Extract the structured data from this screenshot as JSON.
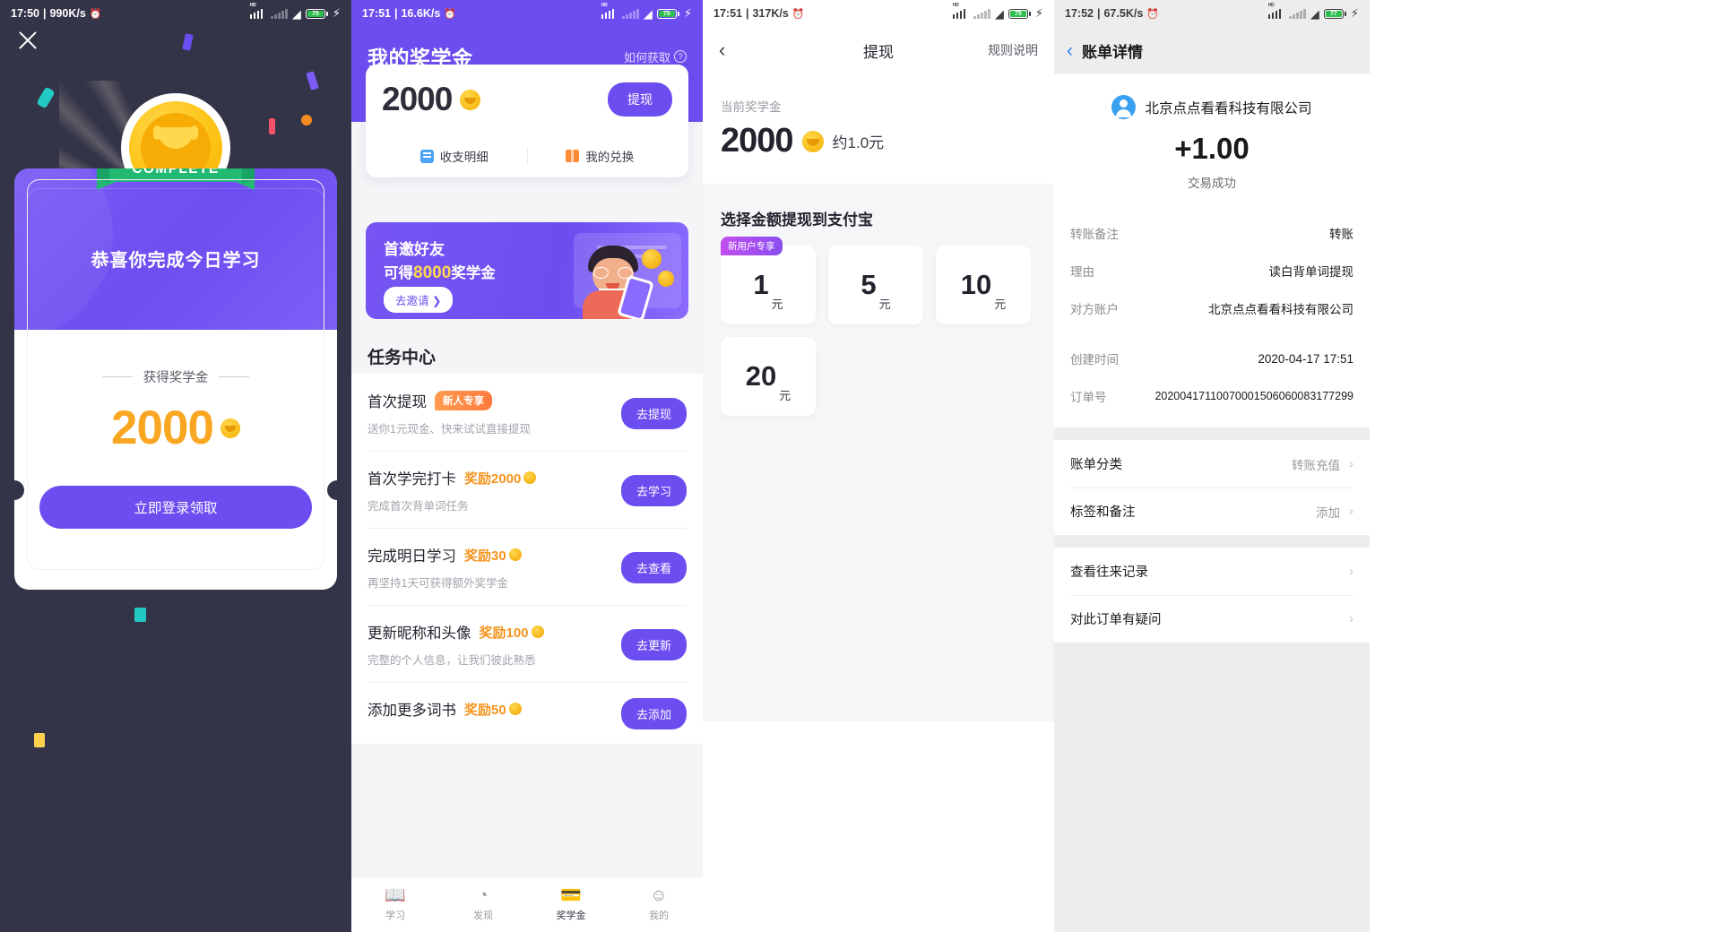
{
  "panel1": {
    "status": {
      "time": "17:50",
      "speed": "990K/s",
      "battery": "75",
      "network": "HD"
    },
    "close_icon": "close-icon",
    "ribbon_label": "COMPLETE",
    "congrats": "恭喜你完成今日学习",
    "got_label": "获得奖学金",
    "amount": "2000",
    "cta_label": "立即登录领取"
  },
  "panel2": {
    "status": {
      "time": "17:51",
      "speed": "16.6K/s",
      "battery": "75",
      "network": "HD"
    },
    "title": "我的奖学金",
    "howto": "如何获取",
    "balance": "2000",
    "withdraw_button": "提现",
    "links": [
      {
        "label": "收支明细",
        "icon": "list-icon"
      },
      {
        "label": "我的兑换",
        "icon": "gift-icon"
      }
    ],
    "banner": {
      "line1": "首邀好友",
      "line2_pre": "可得",
      "line2_num": "8000",
      "line2_post": "奖学金",
      "button": "去邀请 ❯"
    },
    "task_header": "任务中心",
    "tasks": [
      {
        "title": "首次提现",
        "tag": "新人专享",
        "reward": "",
        "sub": "送你1元现金、快来试试直接提现",
        "button": "去提现"
      },
      {
        "title": "首次学完打卡",
        "tag": "",
        "reward": "奖励2000",
        "sub": "完成首次背单词任务",
        "button": "去学习"
      },
      {
        "title": "完成明日学习",
        "tag": "",
        "reward": "奖励30",
        "sub": "再坚持1天可获得额外奖学金",
        "button": "去查看"
      },
      {
        "title": "更新昵称和头像",
        "tag": "",
        "reward": "奖励100",
        "sub": "完整的个人信息，让我们彼此熟悉",
        "button": "去更新"
      },
      {
        "title": "添加更多词书",
        "tag": "",
        "reward": "奖励50",
        "sub": "",
        "button": "去添加"
      }
    ],
    "tabs": [
      {
        "label": "学习",
        "icon": "book-icon",
        "active": false
      },
      {
        "label": "发现",
        "icon": "compass-icon",
        "active": false
      },
      {
        "label": "奖学金",
        "icon": "wallet-icon",
        "active": true
      },
      {
        "label": "我的",
        "icon": "person-icon",
        "active": false
      }
    ]
  },
  "panel3": {
    "status": {
      "time": "17:51",
      "speed": "317K/s",
      "battery": "75",
      "network": "HD"
    },
    "nav_title": "提现",
    "nav_right": "规则说明",
    "back_icon": "chevron-left-icon",
    "current_label": "当前奖学金",
    "current_amount": "2000",
    "approx": "约1.0元",
    "select_title": "选择金额提现到支付宝",
    "options": [
      {
        "value": "1",
        "unit": "元",
        "tag": "新用户专享"
      },
      {
        "value": "5",
        "unit": "元",
        "tag": ""
      },
      {
        "value": "10",
        "unit": "元",
        "tag": ""
      },
      {
        "value": "20",
        "unit": "元",
        "tag": ""
      }
    ]
  },
  "panel4": {
    "status": {
      "time": "17:52",
      "speed": "67.5K/s",
      "battery": "77",
      "network": "HD"
    },
    "nav_title": "账单详情",
    "back_icon": "chevron-left-icon",
    "payee": "北京点点看看科技有限公司",
    "amount": "+1.00",
    "status_text": "交易成功",
    "detail_rows": [
      {
        "key": "转账备注",
        "value": "转账"
      },
      {
        "key": "理由",
        "value": "读白背单词提现"
      },
      {
        "key": "对方账户",
        "value": "北京点点看看科技有限公司"
      }
    ],
    "meta_rows": [
      {
        "key": "创建时间",
        "value": "2020-04-17 17:51"
      },
      {
        "key": "订单号",
        "value": "20200417110070001506060083177299"
      }
    ],
    "action_rows": [
      {
        "label": "账单分类",
        "value": "转账充值"
      },
      {
        "label": "标签和备注",
        "value": "添加"
      }
    ],
    "link_rows": [
      {
        "label": "查看往来记录",
        "value": ""
      },
      {
        "label": "对此订单有疑问",
        "value": ""
      }
    ]
  },
  "colors": {
    "purple": "#6c4ef0",
    "orange": "#f9a722",
    "green": "#22ba73",
    "blue": "#2d7ff9"
  }
}
